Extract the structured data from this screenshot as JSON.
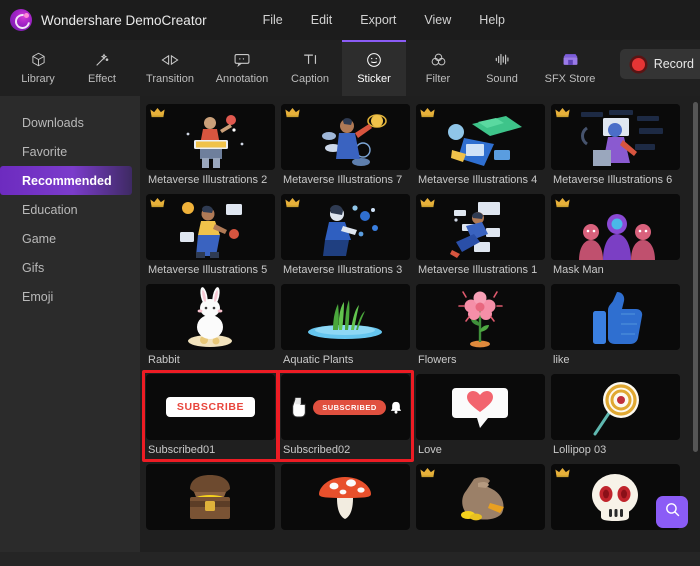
{
  "window": {
    "app_title": "Wondershare DemoCreator",
    "logo_icon": "democreator-logo-icon"
  },
  "menubar": {
    "items": [
      {
        "label": "File"
      },
      {
        "label": "Edit"
      },
      {
        "label": "Export"
      },
      {
        "label": "View"
      },
      {
        "label": "Help"
      }
    ]
  },
  "toolbar": {
    "tabs": [
      {
        "label": "Library",
        "icon": "cube-icon",
        "active": false
      },
      {
        "label": "Effect",
        "icon": "magic-wand-icon",
        "active": false
      },
      {
        "label": "Transition",
        "icon": "transition-icon",
        "active": false
      },
      {
        "label": "Annotation",
        "icon": "speech-bubble-icon",
        "active": false
      },
      {
        "label": "Caption",
        "icon": "text-caption-icon",
        "active": false
      },
      {
        "label": "Sticker",
        "icon": "smiley-face-icon",
        "active": true
      },
      {
        "label": "Filter",
        "icon": "filter-circles-icon",
        "active": false
      },
      {
        "label": "Sound",
        "icon": "waveform-icon",
        "active": false
      },
      {
        "label": "SFX Store",
        "icon": "sfx-store-icon",
        "active": false
      }
    ],
    "record_button": {
      "label": "Record",
      "icon": "record-dot-icon",
      "color": "#e63535"
    },
    "active_tab_accent": "#8b5cf6"
  },
  "sidebar": {
    "items": [
      {
        "label": "Downloads",
        "active": false
      },
      {
        "label": "Favorite",
        "active": false
      },
      {
        "label": "Recommended",
        "active": true
      },
      {
        "label": "Education",
        "active": false
      },
      {
        "label": "Game",
        "active": false
      },
      {
        "label": "Gifs",
        "active": false
      },
      {
        "label": "Emoji",
        "active": false
      }
    ],
    "active_color": "#6d2bbf"
  },
  "stickers": [
    {
      "label": "Metaverse Illustrations 2",
      "art": "metaverse-2",
      "premium": true,
      "highlighted": false
    },
    {
      "label": "Metaverse Illustrations 7",
      "art": "metaverse-7",
      "premium": true,
      "highlighted": false
    },
    {
      "label": "Metaverse Illustrations 4",
      "art": "metaverse-4",
      "premium": true,
      "highlighted": false
    },
    {
      "label": "Metaverse Illustrations 6",
      "art": "metaverse-6",
      "premium": true,
      "highlighted": false
    },
    {
      "label": "Metaverse Illustrations 5",
      "art": "metaverse-5",
      "premium": true,
      "highlighted": false
    },
    {
      "label": "Metaverse Illustrations 3",
      "art": "metaverse-3",
      "premium": true,
      "highlighted": false
    },
    {
      "label": "Metaverse Illustrations 1",
      "art": "metaverse-1",
      "premium": true,
      "highlighted": false
    },
    {
      "label": "Mask Man",
      "art": "mask-man",
      "premium": true,
      "highlighted": false
    },
    {
      "label": "Rabbit",
      "art": "rabbit",
      "premium": false,
      "highlighted": false
    },
    {
      "label": "Aquatic Plants",
      "art": "aquatic",
      "premium": false,
      "highlighted": false
    },
    {
      "label": "Flowers",
      "art": "flower",
      "premium": false,
      "highlighted": false
    },
    {
      "label": "like",
      "art": "thumbs-up",
      "premium": false,
      "highlighted": false
    },
    {
      "label": "Subscribed01",
      "art": "subscribe",
      "premium": false,
      "highlighted": true
    },
    {
      "label": "Subscribed02",
      "art": "subscribed",
      "premium": false,
      "highlighted": true
    },
    {
      "label": "Love",
      "art": "love",
      "premium": false,
      "highlighted": false
    },
    {
      "label": "Lollipop 03",
      "art": "lollipop",
      "premium": false,
      "highlighted": false
    },
    {
      "label": "",
      "art": "treasure",
      "premium": false,
      "highlighted": false
    },
    {
      "label": "",
      "art": "mushroom",
      "premium": false,
      "highlighted": false
    },
    {
      "label": "",
      "art": "money-bag",
      "premium": true,
      "highlighted": false
    },
    {
      "label": "",
      "art": "skull",
      "premium": true,
      "highlighted": false
    }
  ],
  "sticker_art_text": {
    "subscribe_label": "SUBSCRIBE",
    "subscribed_label": "SUBSCRIBED"
  },
  "search": {
    "icon": "search-icon",
    "color": "#8b5cf6"
  },
  "highlight": {
    "color": "#ed1c24"
  },
  "scrollbar": {
    "name": "vertical-scrollbar"
  }
}
